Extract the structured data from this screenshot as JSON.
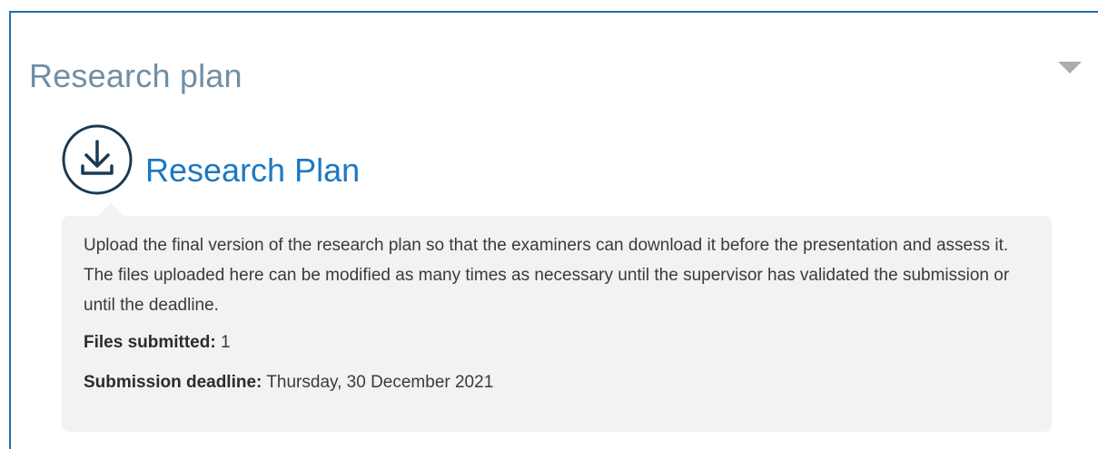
{
  "section": {
    "title": "Research plan",
    "toggle_icon": "chevron-down-icon"
  },
  "activity": {
    "icon": "download-icon",
    "title": "Research Plan",
    "description": "Upload the final version of the research plan so that the examiners can download it before the presentation and assess it. The files uploaded here can be modified as many times as necessary until the supervisor has validated the submission or until the deadline.",
    "files_submitted_label": "Files submitted:",
    "files_submitted_value": "1",
    "deadline_label": "Submission deadline:",
    "deadline_value": "Thursday, 30 December 2021"
  },
  "colors": {
    "frame_border": "#1f6fb2",
    "link": "#1b78c2",
    "section_title": "#6f8fa6",
    "box_bg": "#f2f2f2"
  }
}
